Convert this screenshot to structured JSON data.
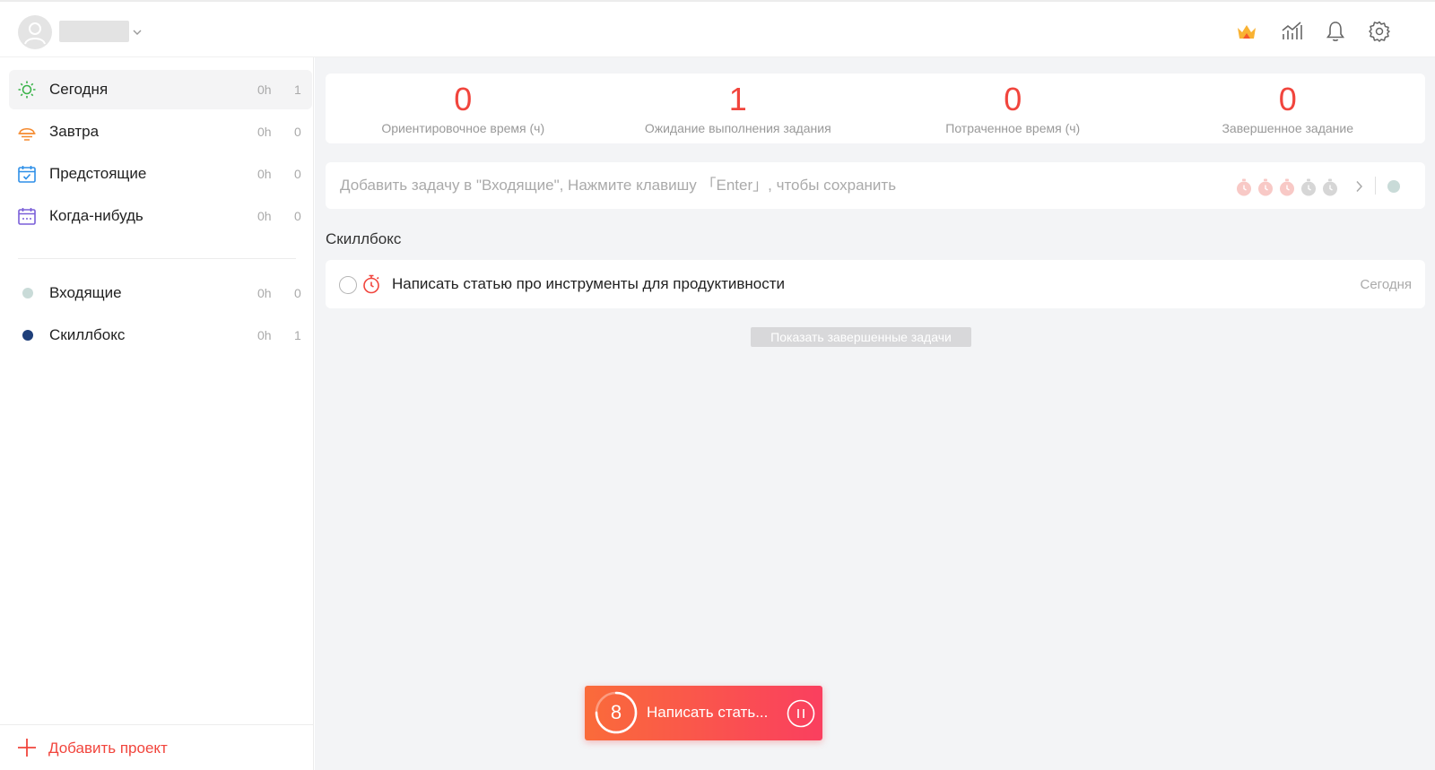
{
  "header": {
    "user_name": "",
    "icons": [
      "crown-icon",
      "statistics-icon",
      "bell-icon",
      "gear-icon"
    ]
  },
  "sidebar": {
    "smart_lists": [
      {
        "label": "Сегодня",
        "hours": "0h",
        "count": "1",
        "icon": "sun-icon",
        "color": "#3cb44b",
        "active": true
      },
      {
        "label": "Завтра",
        "hours": "0h",
        "count": "0",
        "icon": "sunset-icon",
        "color": "#f58a2e"
      },
      {
        "label": "Предстоящие",
        "hours": "0h",
        "count": "0",
        "icon": "calendar-check-icon",
        "color": "#2e8fe8"
      },
      {
        "label": "Когда-нибудь",
        "hours": "0h",
        "count": "0",
        "icon": "calendar-dots-icon",
        "color": "#7a5fd8"
      }
    ],
    "projects": [
      {
        "label": "Входящие",
        "hours": "0h",
        "count": "0",
        "color": "#c9dbd8"
      },
      {
        "label": "Скиллбокс",
        "hours": "0h",
        "count": "1",
        "color": "#1f3f7a"
      }
    ],
    "add_project_label": "Добавить проект"
  },
  "stats": [
    {
      "value": "0",
      "label": "Ориентировочное время (ч)"
    },
    {
      "value": "1",
      "label": "Ожидание выполнения задания"
    },
    {
      "value": "0",
      "label": "Потраченное время (ч)"
    },
    {
      "value": "0",
      "label": "Завершенное задание"
    }
  ],
  "add_task": {
    "placeholder": "Добавить задачу в \"Входящие\", Нажмите клавишу 「Enter」, чтобы сохранить",
    "pomodoro_estimate": {
      "selected": 3,
      "total": 5
    }
  },
  "section": {
    "title": "Скиллбокс",
    "tasks": [
      {
        "title": "Написать статью про инструменты для продуктивности",
        "due": "Сегодня"
      }
    ]
  },
  "show_completed_label": "Показать завершенные задачи",
  "floating_timer": {
    "minutes": "8",
    "task_title": "Написать стать...",
    "progress": 0.75
  },
  "colors": {
    "accent": "#f1453d",
    "timer_gradient_start": "#fa6b3a",
    "timer_gradient_end": "#fa3f5f"
  }
}
